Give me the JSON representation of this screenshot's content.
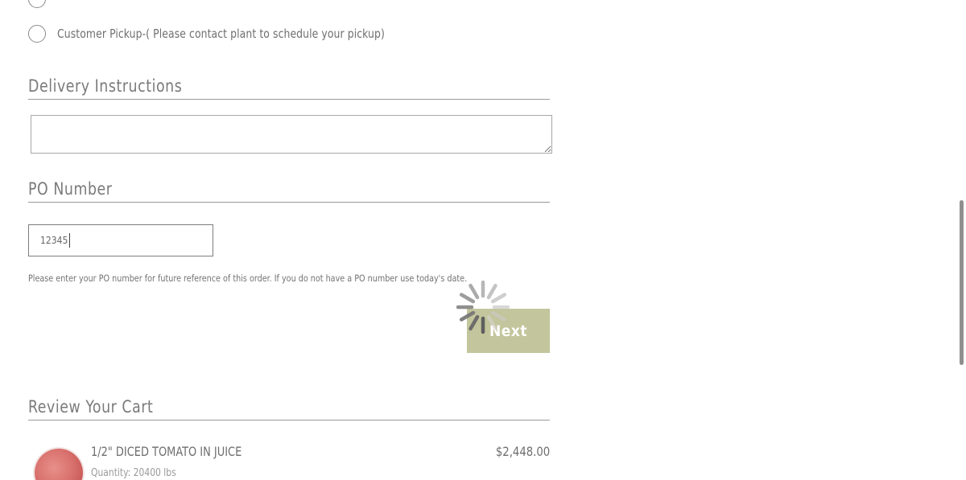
{
  "shipping": {
    "partial_option_label": "",
    "pickup_option_label": "Customer Pickup-( Please contact plant to schedule your pickup)"
  },
  "delivery": {
    "title": "Delivery Instructions",
    "value": ""
  },
  "po": {
    "title": "PO Number",
    "value": "12345",
    "help_text": "Please enter your PO number for future reference of this order. If you do not have a PO number use today's date."
  },
  "actions": {
    "next_label": "Next",
    "loading": true
  },
  "cart": {
    "title": "Review Your Cart",
    "items": [
      {
        "name": "1/2\" DICED TOMATO IN JUICE",
        "quantity": "Quantity: 20400 lbs",
        "price": "$2,448.00"
      }
    ]
  },
  "colors": {
    "next_button": "#c3c59c",
    "text": "#6d6d6d",
    "divider": "#9a9a9a"
  }
}
